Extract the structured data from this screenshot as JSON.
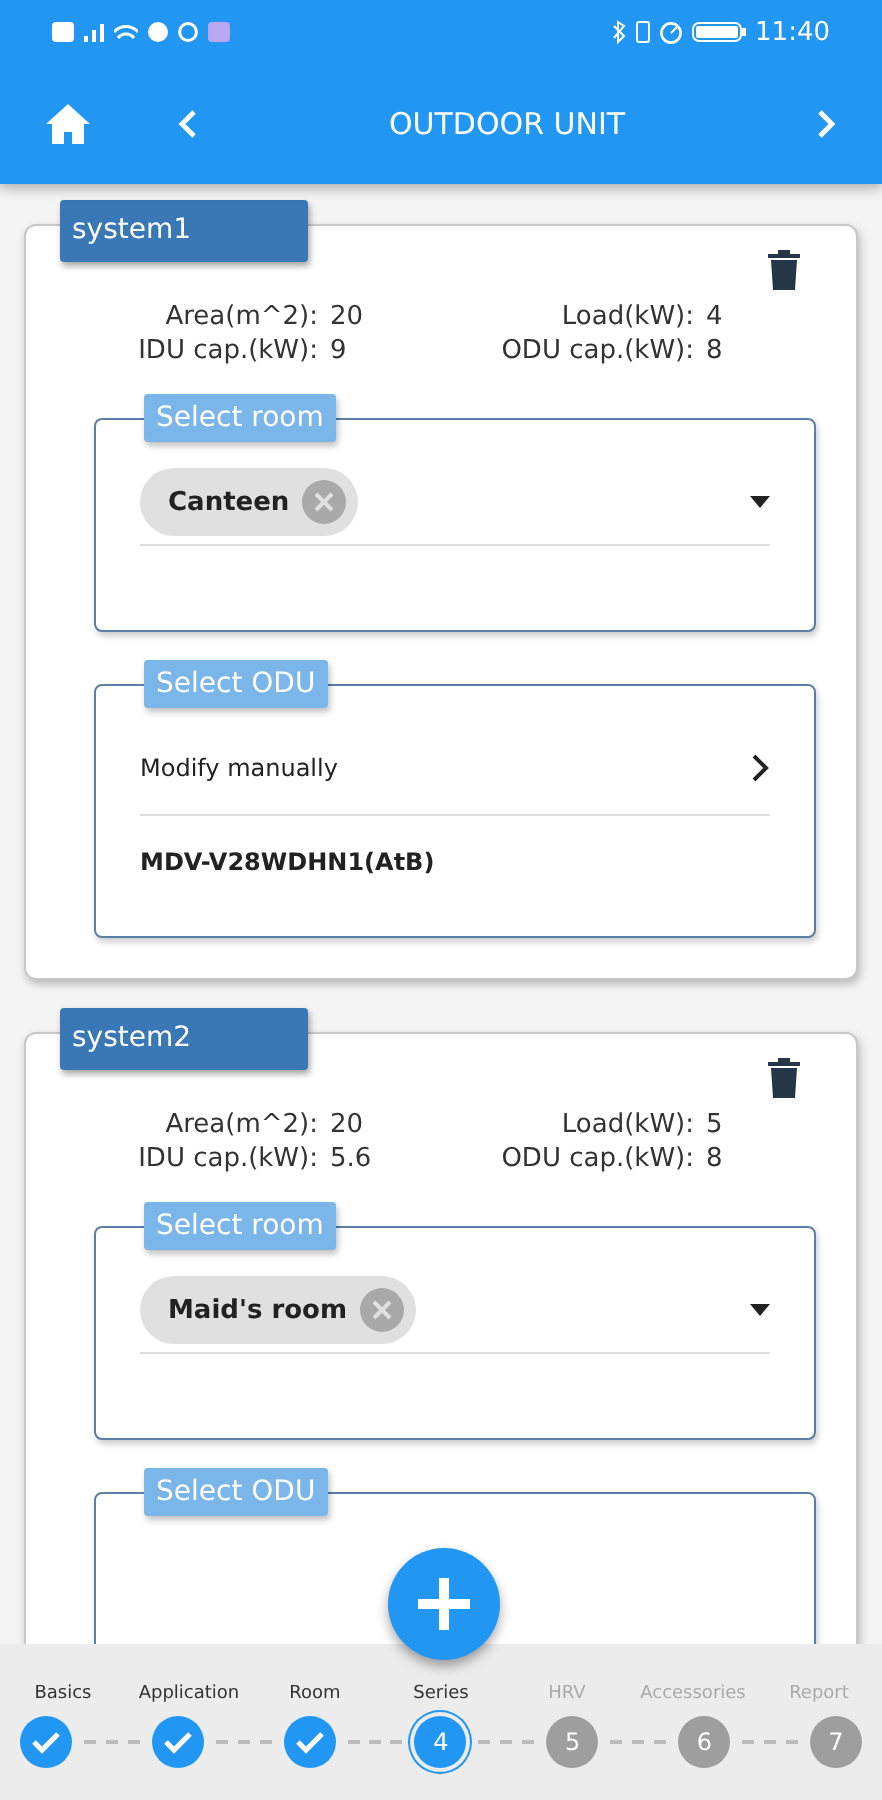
{
  "status_bar": {
    "time": "11:40"
  },
  "header": {
    "title": "OUTDOOR UNIT"
  },
  "systems": [
    {
      "name": "system1",
      "stats": [
        {
          "label": "Area(m^2):",
          "value": "20"
        },
        {
          "label": "Load(kW):",
          "value": "4"
        },
        {
          "label": "IDU cap.(kW):",
          "value": "9"
        },
        {
          "label": "ODU cap.(kW):",
          "value": "8"
        }
      ],
      "room_select": {
        "label": "Select room",
        "chips": [
          "Canteen"
        ]
      },
      "odu_select": {
        "label": "Select ODU",
        "options": [
          {
            "kind": "link",
            "text": "Modify manually"
          },
          {
            "kind": "value",
            "text": "MDV-V28WDHN1(AtB)"
          }
        ]
      }
    },
    {
      "name": "system2",
      "stats": [
        {
          "label": "Area(m^2):",
          "value": "20"
        },
        {
          "label": "Load(kW):",
          "value": "5"
        },
        {
          "label": "IDU cap.(kW):",
          "value": "5.6"
        },
        {
          "label": "ODU cap.(kW):",
          "value": "8"
        }
      ],
      "room_select": {
        "label": "Select room",
        "chips": [
          "Maid's room"
        ]
      },
      "odu_select": {
        "label": "Select ODU"
      }
    }
  ],
  "steps": [
    {
      "label": "Basics",
      "done": true,
      "current": false
    },
    {
      "label": "Application",
      "done": true,
      "current": false
    },
    {
      "label": "Room",
      "done": true,
      "current": false
    },
    {
      "label": "Series",
      "done": false,
      "current": true,
      "number": "4"
    },
    {
      "label": "HRV",
      "done": false,
      "current": false,
      "number": "5"
    },
    {
      "label": "Accessories",
      "done": false,
      "current": false,
      "number": "6"
    },
    {
      "label": "Report",
      "done": false,
      "current": false,
      "number": "7"
    }
  ]
}
